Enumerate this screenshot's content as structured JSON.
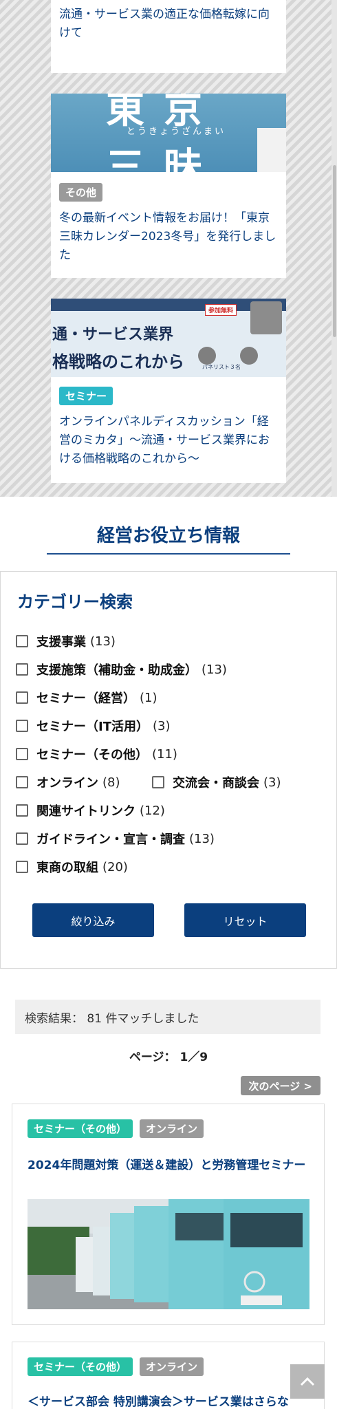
{
  "top_cards": [
    {
      "title": "流通・サービス業の適正な価格転嫁に向けて"
    },
    {
      "thumb_text": {
        "big1": "東京",
        "kana": "とうきょうざんまい",
        "big2": "三昧"
      },
      "tag": "その他",
      "title": "冬の最新イベント情報をお届け！「東京三昧カレンダー2023冬号」を発行しました"
    },
    {
      "thumb_text": {
        "line1": "通・サービス業界",
        "line2": "格戦略のこれから",
        "badge": "参加無料",
        "sub": "パネリスト３名"
      },
      "tag": "セミナー",
      "title": "オンラインパネルディスカッション「経営のミカタ」〜流通・サービス業界における価格戦略のこれから〜"
    }
  ],
  "section_title": "経営お役立ち情報",
  "category_search": {
    "title": "カテゴリー検索",
    "items": [
      {
        "label": "支援事業",
        "count": "(13)"
      },
      {
        "label": "支援施策（補助金・助成金）",
        "count": "(13)"
      },
      {
        "label": "セミナー（経営）",
        "count": "(1)"
      },
      {
        "label": "セミナー（IT活用）",
        "count": "(3)"
      },
      {
        "label": "セミナー（その他）",
        "count": "(11)"
      },
      {
        "label": "オンライン",
        "count": "(8)"
      },
      {
        "label": "交流会・商談会",
        "count": "(3)"
      },
      {
        "label": "関連サイトリンク",
        "count": "(12)"
      },
      {
        "label": "ガイドライン・宣言・調査",
        "count": "(13)"
      },
      {
        "label": "東商の取組",
        "count": "(20)"
      }
    ],
    "filter_button": "絞り込み",
    "reset_button": "リセット"
  },
  "results": {
    "summary": "検索結果： 81 件マッチしました",
    "page": "ページ：  1／9",
    "next": "次のページ >",
    "cards": [
      {
        "tags": [
          "セミナー（その他）",
          "オンライン"
        ],
        "title": "2024年問題対策（運送＆建設）と労務管理セミナー"
      },
      {
        "tags": [
          "セミナー（その他）",
          "オンライン"
        ],
        "title": "＜サービス部会 特別講演会＞サービス業はさらな"
      }
    ]
  },
  "colors": {
    "navy": "#0b3f7e",
    "teal": "#2bb8c8",
    "green": "#28c1a5",
    "gray": "#9a9a9a"
  }
}
